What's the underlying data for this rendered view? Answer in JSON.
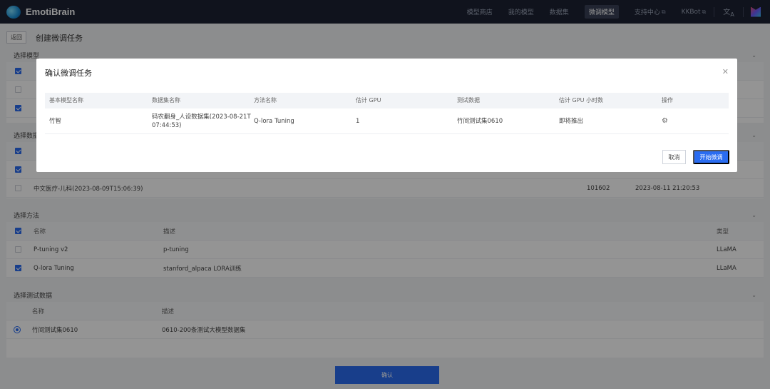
{
  "header": {
    "brand": "EmotiBrain",
    "nav": [
      {
        "label": "模型商店"
      },
      {
        "label": "我的模型"
      },
      {
        "label": "数据集"
      },
      {
        "label": "微调模型"
      },
      {
        "label": "支持中心",
        "ext": "⧉"
      },
      {
        "label": "KKBot",
        "ext": "⧉"
      }
    ],
    "lang_icon": "translate-icon"
  },
  "page": {
    "back_label": "返回",
    "title": "创建微调任务",
    "confirm_label": "确认"
  },
  "sections": {
    "model": {
      "title": "选择模型"
    },
    "dataset": {
      "title": "选择数据集",
      "visible_row": {
        "name": "中文医疗-儿科(2023-08-09T15:06:39)",
        "count": "101602",
        "time": "2023-08-11 21:20:53"
      }
    },
    "method": {
      "title": "选择方法",
      "headers": {
        "name": "名称",
        "desc": "描述",
        "type": "类型"
      },
      "rows": [
        {
          "name": "P-tuning v2",
          "desc": "p-tuning",
          "type": "LLaMA"
        },
        {
          "name": "Q-lora Tuning",
          "desc": "stanford_alpaca LORA训练",
          "type": "LLaMA"
        }
      ]
    },
    "test": {
      "title": "选择测试数据",
      "headers": {
        "name": "名称",
        "desc": "描述"
      },
      "rows": [
        {
          "name": "竹间测试集0610",
          "desc": "0610-200条测试大模型数据集"
        }
      ]
    }
  },
  "modal": {
    "title": "确认微调任务",
    "headers": [
      "基本模型名称",
      "数据集名称",
      "方法名称",
      "估计 GPU",
      "测试数据",
      "估计 GPU 小时数",
      "操作"
    ],
    "row": {
      "model": "竹智",
      "dataset_line1": "码农翻身_人设数据集(2023-08-21T",
      "dataset_line2": "07:44:53)",
      "method": "Q-lora Tuning",
      "gpu": "1",
      "test": "竹间测试集0610",
      "gpu_hours": "即将推出"
    },
    "cancel_label": "取消",
    "start_label": "开始微调"
  }
}
